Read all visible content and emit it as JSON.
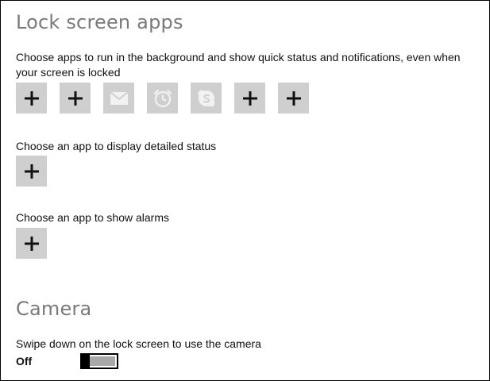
{
  "lock_screen_apps": {
    "title": "Lock screen apps",
    "description": "Choose apps to run in the background and show quick status and notifications, even when your screen is locked",
    "slots": [
      {
        "icon": "plus-icon",
        "state": "empty"
      },
      {
        "icon": "plus-icon",
        "state": "empty"
      },
      {
        "icon": "mail-icon",
        "state": "app"
      },
      {
        "icon": "alarm-clock-icon",
        "state": "app"
      },
      {
        "icon": "skype-icon",
        "state": "app"
      },
      {
        "icon": "plus-icon",
        "state": "empty"
      },
      {
        "icon": "plus-icon",
        "state": "empty"
      }
    ]
  },
  "detailed_status": {
    "label": "Choose an app to display detailed status",
    "icon": "plus-icon"
  },
  "alarms": {
    "label": "Choose an app to show alarms",
    "icon": "plus-icon"
  },
  "camera": {
    "title": "Camera",
    "description": "Swipe down on the lock screen to use the camera",
    "toggle_label": "Off",
    "toggle_on": false
  },
  "colors": {
    "title_gray": "#7a7a7a",
    "tile_bg": "#cfcfcf",
    "app_icon": "#f2f2f2",
    "toggle_track": "#a8a8a8"
  }
}
